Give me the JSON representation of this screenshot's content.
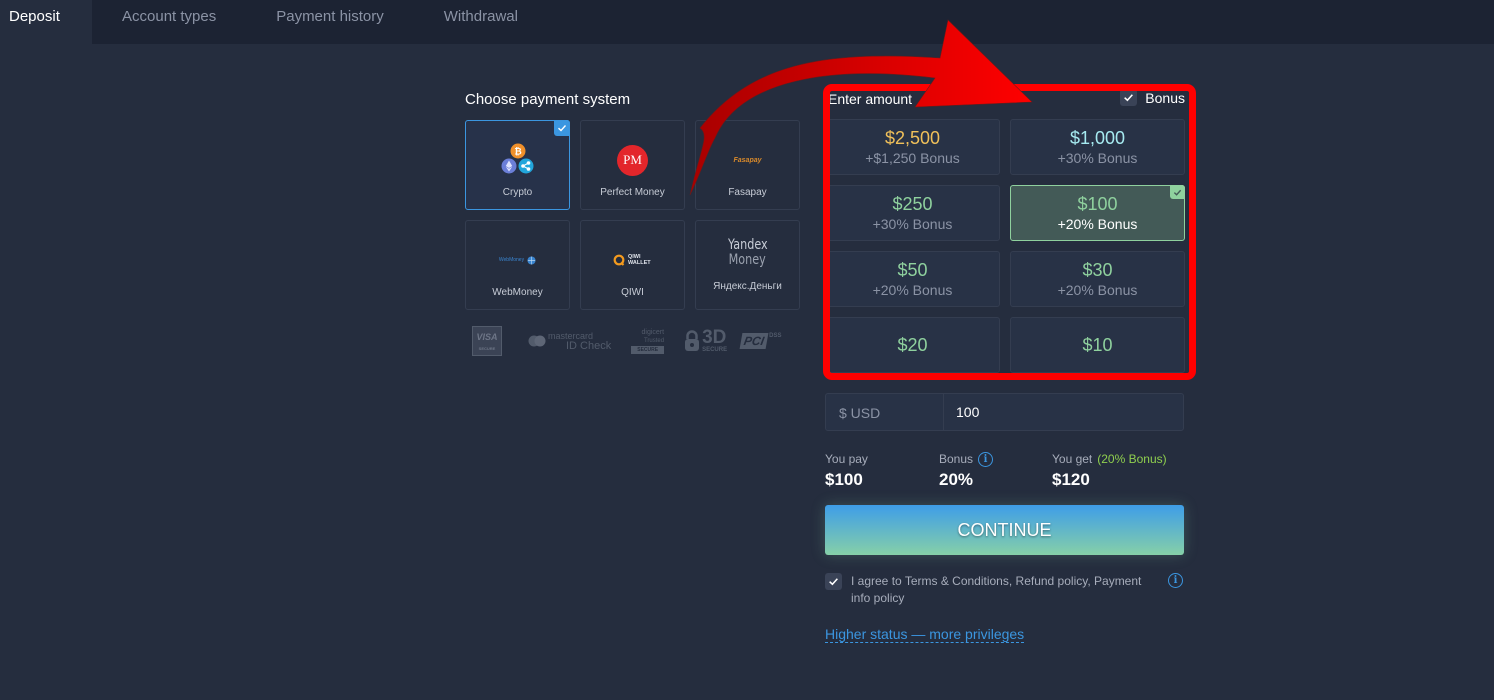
{
  "tabs": [
    {
      "label": "Deposit",
      "active": true
    },
    {
      "label": "Account types"
    },
    {
      "label": "Payment history"
    },
    {
      "label": "Withdrawal"
    }
  ],
  "payment": {
    "title": "Choose payment system",
    "methods": [
      {
        "name": "Crypto",
        "icon": "crypto-icon",
        "selected": true
      },
      {
        "name": "Perfect Money",
        "icon": "perfect-money-logo",
        "logo_text": "PM"
      },
      {
        "name": "Fasapay",
        "icon": "fasapay-logo",
        "logo_text": "Fasapay"
      },
      {
        "name": "WebMoney",
        "icon": "webmoney-logo",
        "logo_text": "WebMoney"
      },
      {
        "name": "QIWI",
        "icon": "qiwi-logo",
        "logo_text": "QIWI WALLET"
      },
      {
        "name": "Яндекс.Деньги",
        "icon": "yandex-money-logo",
        "logo_text_1": "Yandex",
        "logo_text_2": "Money"
      }
    ],
    "security_badges": {
      "visa_1": "VISA",
      "visa_2": "SECURE",
      "mc_1": "mastercard",
      "mc_2": "ID Check",
      "digicert_1": "digicert",
      "digicert_2": "Trusted",
      "digicert_3": "SECURE",
      "three_d_1": "3D",
      "three_d_2": "SECURE",
      "pci_1": "PCI",
      "pci_2": "DSS"
    }
  },
  "amount": {
    "title": "Enter amount",
    "bonus_label": "Bonus",
    "bonus_checked": true,
    "options": [
      {
        "value": "$2,500",
        "bonus": "+$1,250 Bonus",
        "color": "#f0c05a"
      },
      {
        "value": "$1,000",
        "bonus": "+30% Bonus",
        "color": "#a6eaf0"
      },
      {
        "value": "$250",
        "bonus": "+30% Bonus",
        "color": "#8fd19e"
      },
      {
        "value": "$100",
        "bonus": "+20% Bonus",
        "color": "#8fd19e",
        "selected": true
      },
      {
        "value": "$50",
        "bonus": "+20% Bonus",
        "color": "#8fd19e"
      },
      {
        "value": "$30",
        "bonus": "+20% Bonus",
        "color": "#8fd19e"
      },
      {
        "value": "$20",
        "bonus": "",
        "color": "#8fd19e"
      },
      {
        "value": "$10",
        "bonus": "",
        "color": "#8fd19e"
      }
    ],
    "currency_label": "$ USD",
    "input_value": "100"
  },
  "summary": {
    "you_pay_label": "You pay",
    "you_pay_value": "$100",
    "bonus_label": "Bonus",
    "bonus_value": "20%",
    "you_get_label": "You get",
    "you_get_note": "(20% Bonus)",
    "you_get_value": "$120"
  },
  "continue_label": "CONTINUE",
  "agree_text": "I agree to Terms & Conditions, Refund policy, Payment info policy",
  "agree_checked": true,
  "higher_status_link": "Higher status — more privileges",
  "annotation_color": "#ff0000"
}
